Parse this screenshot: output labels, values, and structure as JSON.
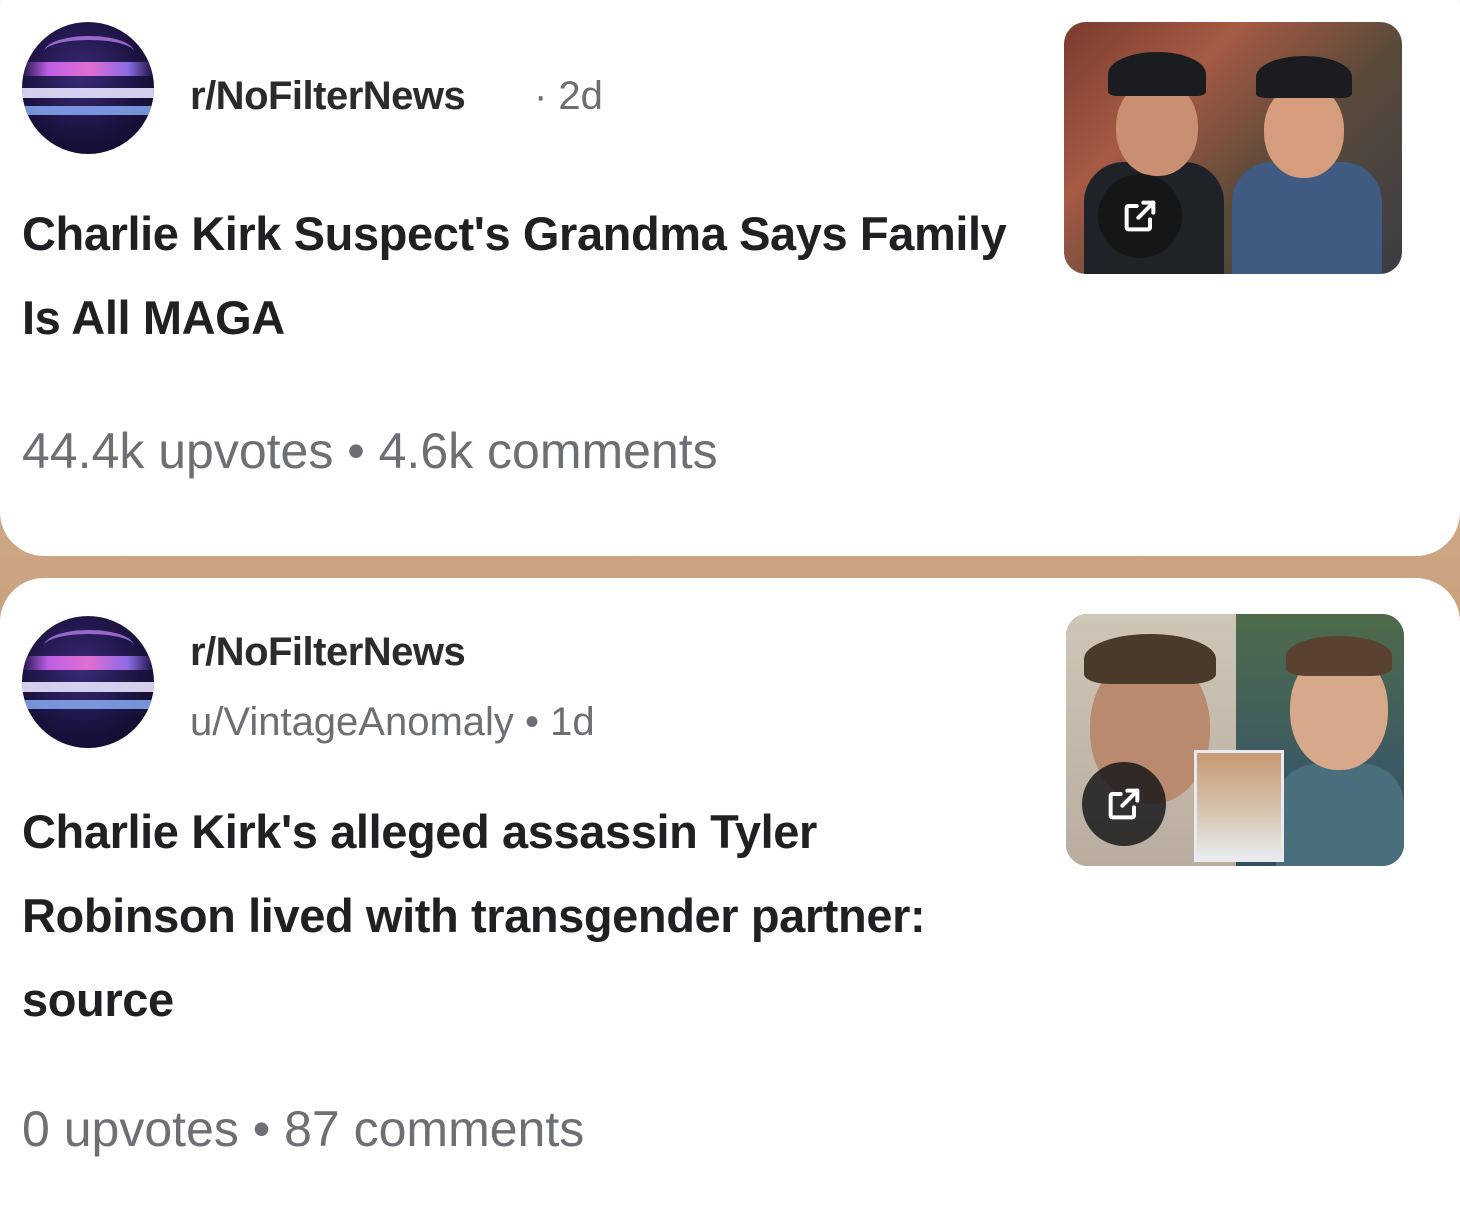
{
  "posts": [
    {
      "subreddit": "r/NoFilterNews",
      "meta": "· 2d",
      "title": "Charlie Kirk Suspect's Grandma Says Family Is All MAGA",
      "stats": "44.4k upvotes • 4.6k comments"
    },
    {
      "subreddit": "r/NoFilterNews",
      "meta": "u/VintageAnomaly • 1d",
      "title": "Charlie Kirk's alleged assassin Tyler Robinson lived with transgender partner: source",
      "stats": "0 upvotes • 87 comments"
    }
  ]
}
